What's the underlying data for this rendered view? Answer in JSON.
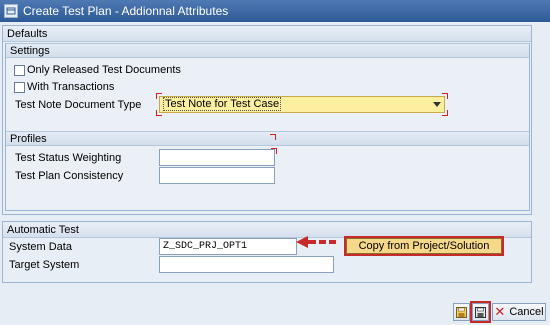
{
  "window": {
    "title": "Create Test Plan - Addionnal Attributes"
  },
  "defaults": {
    "header": "Defaults",
    "settings": {
      "header": "Settings",
      "only_released_label": "Only Released Test Documents",
      "only_released_checked": false,
      "with_transactions_label": "With Transactions",
      "with_transactions_checked": false,
      "test_note_type_label": "Test Note Document Type",
      "test_note_type_value": "Test Note for Test Case"
    },
    "profiles": {
      "header": "Profiles",
      "status_weighting_label": "Test Status Weighting",
      "status_weighting_value": "",
      "plan_consistency_label": "Test Plan Consistency",
      "plan_consistency_value": ""
    }
  },
  "automatic_test": {
    "header": "Automatic Test",
    "system_data_label": "System Data",
    "system_data_value": "Z_SDC_PRJ_OPT1",
    "target_system_label": "Target System",
    "target_system_value": "",
    "copy_button_label": "Copy from Project/Solution"
  },
  "footer": {
    "cancel_label": "Cancel"
  },
  "colors": {
    "highlight": "#c62a2a",
    "copy_button_bg": "#f5d88a",
    "dropdown_bg": "#fcf0a0"
  }
}
